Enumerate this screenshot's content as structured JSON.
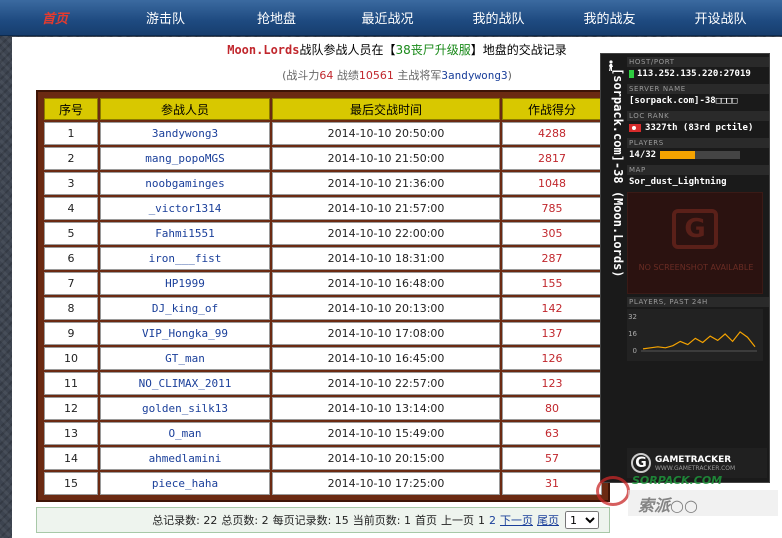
{
  "nav": {
    "logo": "首页",
    "items": [
      "游击队",
      "抢地盘",
      "最近战况",
      "我的战队",
      "我的战友",
      "开设战队"
    ]
  },
  "header": {
    "team_name": "Moon.Lords",
    "text1": "战队参战人员在【",
    "server_name": "38丧尸升级服",
    "text2": "】地盘的交战记录"
  },
  "subheader": {
    "open": "(战斗力",
    "power": "64",
    "record_label": " 战绩",
    "record": "10561",
    "commander_label": " 主战将军",
    "commander": "3andywong3",
    "close": ")"
  },
  "table": {
    "headers": [
      "序号",
      "参战人员",
      "最后交战时间",
      "作战得分"
    ],
    "rows": [
      {
        "no": "1",
        "player": "3andywong3",
        "time": "2014-10-10 20:50:00",
        "score": "4288"
      },
      {
        "no": "2",
        "player": "mang_popoMGS",
        "time": "2014-10-10 21:50:00",
        "score": "2817"
      },
      {
        "no": "3",
        "player": "noobgaminges",
        "time": "2014-10-10 21:36:00",
        "score": "1048"
      },
      {
        "no": "4",
        "player": "_victor1314",
        "time": "2014-10-10 21:57:00",
        "score": "785"
      },
      {
        "no": "5",
        "player": "Fahmi1551",
        "time": "2014-10-10 22:00:00",
        "score": "305"
      },
      {
        "no": "6",
        "player": "iron___fist",
        "time": "2014-10-10 18:31:00",
        "score": "287"
      },
      {
        "no": "7",
        "player": "HP1999",
        "time": "2014-10-10 16:48:00",
        "score": "155"
      },
      {
        "no": "8",
        "player": "DJ_king_of",
        "time": "2014-10-10 20:13:00",
        "score": "142"
      },
      {
        "no": "9",
        "player": "VIP_Hongka_99",
        "time": "2014-10-10 17:08:00",
        "score": "137"
      },
      {
        "no": "10",
        "player": "GT_man",
        "time": "2014-10-10 16:45:00",
        "score": "126"
      },
      {
        "no": "11",
        "player": "NO_CLIMAX_2011",
        "time": "2014-10-10 22:57:00",
        "score": "123"
      },
      {
        "no": "12",
        "player": "golden_silk13",
        "time": "2014-10-10 13:14:00",
        "score": "80"
      },
      {
        "no": "13",
        "player": "O_man",
        "time": "2014-10-10 15:49:00",
        "score": "63"
      },
      {
        "no": "14",
        "player": "ahmedlamini",
        "time": "2014-10-10 20:15:00",
        "score": "57"
      },
      {
        "no": "15",
        "player": "piece_haha",
        "time": "2014-10-10 17:25:00",
        "score": "31"
      }
    ]
  },
  "pager": {
    "total_records": "总记录数: 22",
    "total_pages": "总页数: 2",
    "per_page": "每页记录数: 15",
    "current_page": "当前页数: 1",
    "first": "首页",
    "prev": "上一页",
    "page1": "1",
    "page2": "2",
    "next": "下一页",
    "last": "尾页",
    "select_value": "1"
  },
  "gametracker": {
    "side_text": "[sorpack.com]-38 (Moon.Lords)",
    "host_label": "HOST/PORT",
    "host": "113.252.135.220:27019",
    "server_label": "SERVER NAME",
    "server": "[sorpack.com]-38□□□□",
    "rank_label": "LOC   RANK",
    "rank": "3327th (83rd pctile)",
    "players_label": "PLAYERS",
    "players": "14/32",
    "players_fill": 0.4375,
    "map_label": "MAP",
    "map": "Sor_dust_Lightning",
    "screenshot_logo": "G",
    "screenshot_text": "NO SCREENSHOT AVAILABLE",
    "chart_label": "PLAYERS, PAST 24H",
    "chart_ticks": [
      "32",
      "16",
      "0"
    ],
    "chart_values": [
      2,
      3,
      4,
      3,
      5,
      9,
      6,
      12,
      8,
      14,
      10,
      16,
      9,
      18,
      13,
      4
    ],
    "footer_brand": "GAMETRACKER",
    "footer_url": "WWW.GAMETRACKER.COM",
    "status_color": "#2ecc40",
    "bar_color": "#f5a300"
  },
  "watermark": {
    "text": "SORPACK.COM",
    "sub": "索派○○"
  }
}
